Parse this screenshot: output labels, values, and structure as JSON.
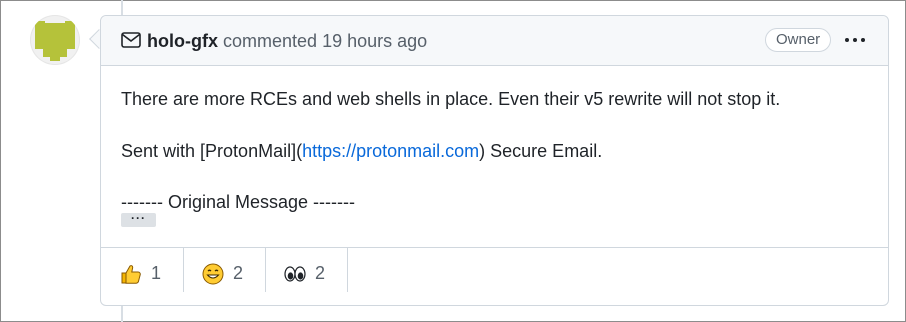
{
  "comment": {
    "author": "holo-gfx",
    "action": "commented",
    "time": "19 hours ago",
    "role_badge": "Owner",
    "body": {
      "line1": "There are more RCEs and web shells in place. Even their v5 rewrite will not stop it.",
      "line2_prefix": "Sent with [ProtonMail](",
      "line2_link": "https://protonmail.com",
      "line2_suffix": ") Secure Email.",
      "line3": "------- Original Message -------",
      "collapsed_label": "···"
    },
    "reactions": [
      {
        "icon": "thumbs-up-icon",
        "count": "1"
      },
      {
        "icon": "smile-icon",
        "count": "2"
      },
      {
        "icon": "eyes-icon",
        "count": "2"
      }
    ]
  },
  "colors": {
    "link": "#0969da",
    "avatar": "#b5c23a",
    "border": "#d0d7de"
  }
}
